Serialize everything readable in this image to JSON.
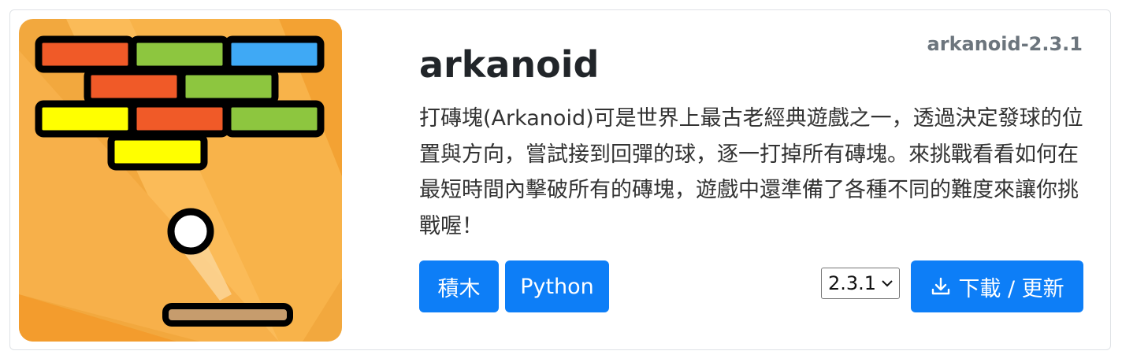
{
  "package": {
    "name": "arkanoid",
    "version_tag": "arkanoid-2.3.1",
    "description": "打磚塊(Arkanoid)可是世界上最古老經典遊戲之一，透過決定發球的位置與方向，嘗試接到回彈的球，逐一打掉所有磚塊。來挑戰看看如何在最短時間內擊破所有的磚塊，遊戲中還準備了各種不同的難度來讓你挑戰喔！"
  },
  "tags": [
    {
      "label": "積木"
    },
    {
      "label": "Python"
    }
  ],
  "version_select": {
    "selected": "2.3.1"
  },
  "download_button": {
    "label": "下載 / 更新",
    "icon": "download-icon"
  },
  "thumbnail": {
    "icon": "arkanoid-game-illustration",
    "colors": {
      "background": "#f4a93d",
      "brick_orange": "#f05a28",
      "brick_green": "#8dc63f",
      "brick_blue": "#3fa9f5",
      "brick_yellow": "#ffff00",
      "paddle": "#c69c6d"
    }
  },
  "colors": {
    "primary": "#0d7ef7",
    "muted": "#6c757d"
  }
}
